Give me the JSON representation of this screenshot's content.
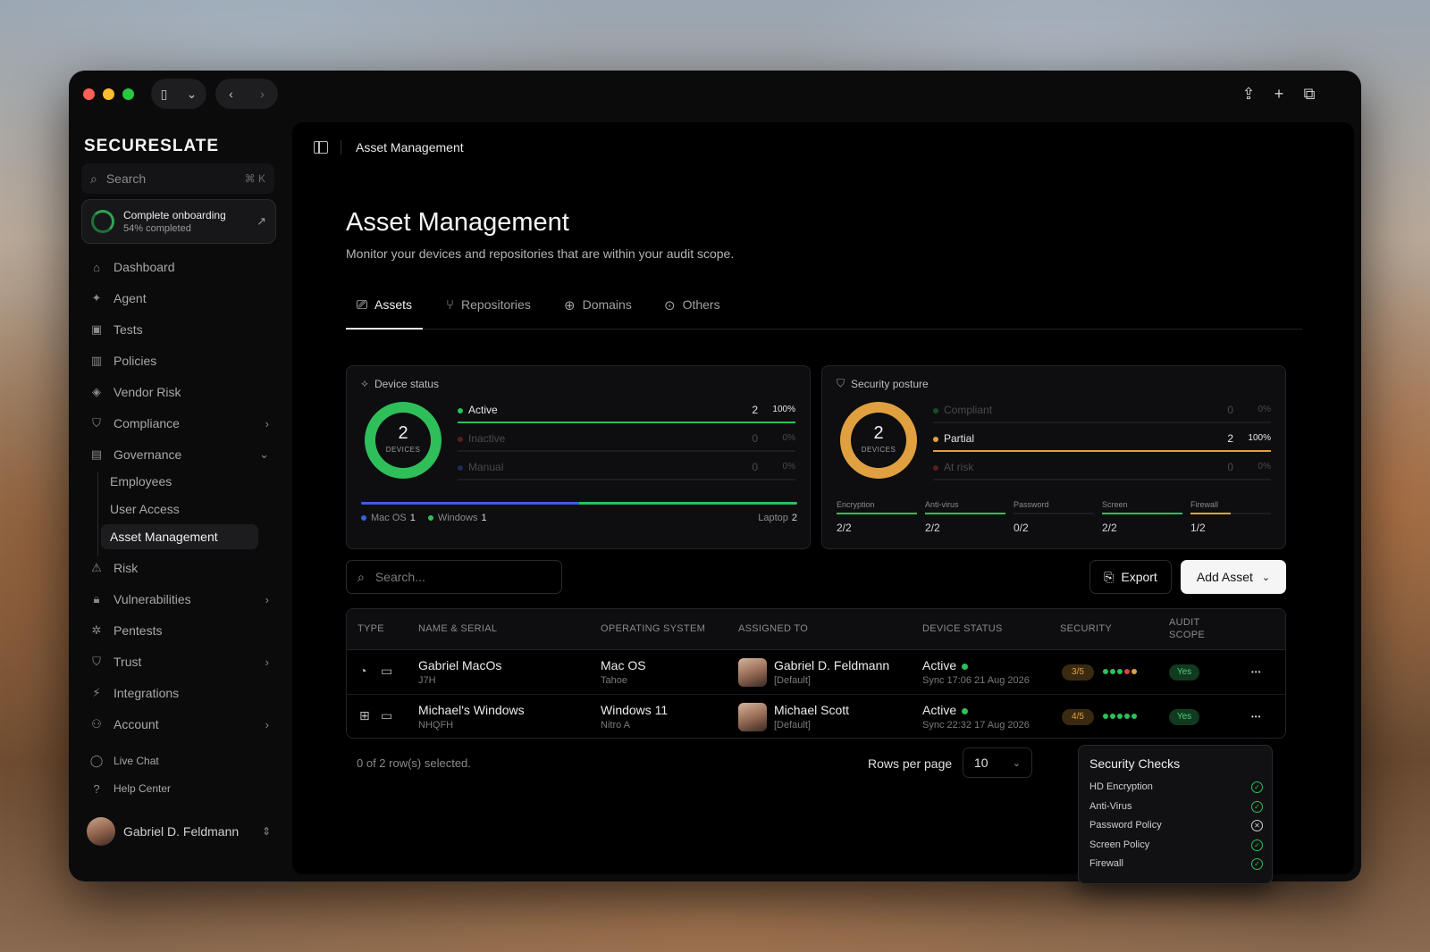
{
  "app": {
    "logo": "SECURESLATE"
  },
  "search": {
    "placeholder": "Search",
    "shortcut": "⌘ K"
  },
  "onboarding": {
    "title": "Complete onboarding",
    "progress": "54% completed",
    "progress_value": 0.54
  },
  "sidebar": {
    "items": [
      {
        "label": "Dashboard",
        "icon": "home-icon"
      },
      {
        "label": "Agent",
        "icon": "sparkle-icon"
      },
      {
        "label": "Tests",
        "icon": "clipboard-icon"
      },
      {
        "label": "Policies",
        "icon": "books-icon"
      },
      {
        "label": "Vendor Risk",
        "icon": "layers-icon"
      },
      {
        "label": "Compliance",
        "icon": "shield-icon"
      },
      {
        "label": "Governance",
        "icon": "document-icon"
      }
    ],
    "governance_sub": [
      "Employees",
      "User Access",
      "Asset Management"
    ],
    "items2": [
      {
        "label": "Risk",
        "icon": "warning-icon"
      },
      {
        "label": "Vulnerabilities",
        "icon": "lock-icon"
      },
      {
        "label": "Pentests",
        "icon": "bug-icon"
      },
      {
        "label": "Trust",
        "icon": "shield-icon"
      },
      {
        "label": "Integrations",
        "icon": "plug-icon"
      },
      {
        "label": "Account",
        "icon": "user-icon"
      }
    ],
    "footer": [
      {
        "label": "Live Chat",
        "icon": "chat-icon"
      },
      {
        "label": "Help Center",
        "icon": "help-icon"
      }
    ],
    "user": "Gabriel D. Feldmann"
  },
  "breadcrumb": "Asset Management",
  "page": {
    "title": "Asset Management",
    "description": "Monitor your devices and repositories that are within your audit scope."
  },
  "tabs": [
    "Assets",
    "Repositories",
    "Domains",
    "Others"
  ],
  "device_status": {
    "title": "Device status",
    "total": "2",
    "total_label": "DEVICES",
    "rows": [
      {
        "label": "Active",
        "count": "2",
        "pct": "100%",
        "fraction": 1.0,
        "color": "#2fbf5a"
      },
      {
        "label": "Inactive",
        "count": "0",
        "pct": "0%",
        "fraction": 0,
        "color": "#e0403a"
      },
      {
        "label": "Manual",
        "count": "0",
        "pct": "0%",
        "fraction": 0,
        "color": "#3a5ee0"
      }
    ],
    "os_legend": [
      {
        "label": "Mac OS",
        "count": "1",
        "color": "#3a5ee0",
        "fraction": 0.5
      },
      {
        "label": "Windows",
        "count": "1",
        "color": "#2fbf5a",
        "fraction": 0.5
      }
    ],
    "device_type": "Laptop",
    "device_type_count": "2"
  },
  "security_posture": {
    "title": "Security posture",
    "total": "2",
    "total_label": "DEVICES",
    "rows": [
      {
        "label": "Compliant",
        "count": "0",
        "pct": "0%",
        "fraction": 0,
        "color": "#2fbf5a"
      },
      {
        "label": "Partial",
        "count": "2",
        "pct": "100%",
        "fraction": 1.0,
        "color": "#e0a040"
      },
      {
        "label": "At risk",
        "count": "0",
        "pct": "0%",
        "fraction": 0,
        "color": "#e0403a"
      }
    ],
    "checks": [
      {
        "label": "Encryption",
        "value": "2/2",
        "fraction": 1.0,
        "color": "#2fbf5a"
      },
      {
        "label": "Anti-virus",
        "value": "2/2",
        "fraction": 1.0,
        "color": "#2fbf5a"
      },
      {
        "label": "Password",
        "value": "0/2",
        "fraction": 0,
        "color": "#e0403a"
      },
      {
        "label": "Screen",
        "value": "2/2",
        "fraction": 1.0,
        "color": "#2fbf5a"
      },
      {
        "label": "Firewall",
        "value": "1/2",
        "fraction": 0.5,
        "color": "#e0a040"
      }
    ]
  },
  "toolbar": {
    "search_placeholder": "Search...",
    "export": "Export",
    "add_asset": "Add Asset"
  },
  "table": {
    "columns": [
      "TYPE",
      "NAME & SERIAL",
      "OPERATING SYSTEM",
      "ASSIGNED TO",
      "DEVICE STATUS",
      "SECURITY",
      "AUDIT",
      "SCOPE"
    ],
    "rows": [
      {
        "name": "Gabriel MacOs",
        "serial": "J7H",
        "os": "Mac OS",
        "os_ver": "Tahoe",
        "assignee": "Gabriel D. Feldmann",
        "assignee_tag": "[Default]",
        "status": "Active",
        "sync": "Sync 17:06 21 Aug 2026",
        "score": "3/5",
        "checks": [
          "#2fbf5a",
          "#2fbf5a",
          "#2fbf5a",
          "#e0403a",
          "#e0a040"
        ],
        "audit": "Yes"
      },
      {
        "name": "Michael's Windows",
        "serial": "NHQFH",
        "os": "Windows 11",
        "os_ver": "Nitro A",
        "assignee": "Michael Scott",
        "assignee_tag": "[Default]",
        "status": "Active",
        "sync": "Sync 22:32 17 Aug 2026",
        "score": "4/5",
        "checks": [
          "#2fbf5a",
          "#2fbf5a",
          "#2fbf5a",
          "#2fbf5a",
          "#2fbf5a"
        ],
        "audit": "Yes"
      }
    ]
  },
  "footer": {
    "selection": "0 of 2 row(s) selected.",
    "rows_per_page_label": "Rows per page",
    "rows_per_page": "10"
  },
  "security_checks": {
    "title": "Security Checks",
    "items": [
      {
        "label": "HD Encryption",
        "passed": true
      },
      {
        "label": "Anti-Virus",
        "passed": true
      },
      {
        "label": "Password Policy",
        "passed": false
      },
      {
        "label": "Screen Policy",
        "passed": true
      },
      {
        "label": "Firewall",
        "passed": true
      }
    ]
  }
}
